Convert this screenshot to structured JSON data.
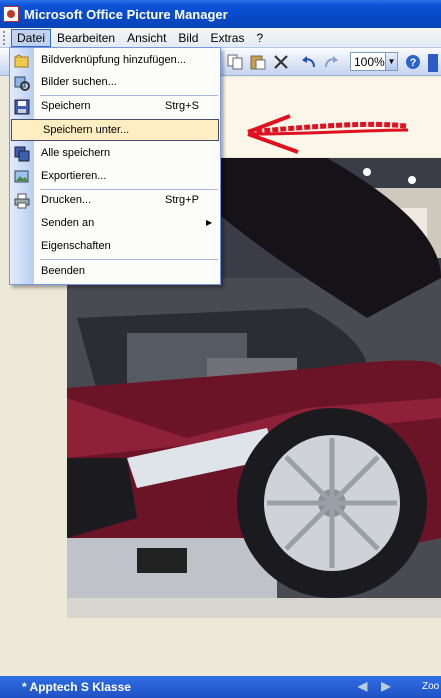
{
  "window": {
    "title": "Microsoft Office Picture Manager"
  },
  "menubar": {
    "items": [
      {
        "label": "Datei"
      },
      {
        "label": "Bearbeiten"
      },
      {
        "label": "Ansicht"
      },
      {
        "label": "Bild"
      },
      {
        "label": "Extras"
      },
      {
        "label": "?"
      }
    ]
  },
  "toolbar": {
    "zoom_value": "100%"
  },
  "file_menu": {
    "items": [
      {
        "label": "Bildverknüpfung hinzufügen...",
        "shortcut": ""
      },
      {
        "label": "Bilder suchen...",
        "shortcut": ""
      },
      {
        "label": "Speichern",
        "shortcut": "Strg+S"
      },
      {
        "label": "Speichern unter...",
        "shortcut": "",
        "highlighted": true
      },
      {
        "label": "Alle speichern",
        "shortcut": ""
      },
      {
        "label": "Exportieren...",
        "shortcut": ""
      },
      {
        "label": "Drucken...",
        "shortcut": "Strg+P"
      },
      {
        "label": "Senden an",
        "shortcut": "",
        "submenu": true
      },
      {
        "label": "Eigenschaften",
        "shortcut": ""
      },
      {
        "label": "Beenden",
        "shortcut": ""
      }
    ]
  },
  "status": {
    "file_name": "* Apptech S Klasse",
    "zoom_label": "Zoo"
  },
  "colors": {
    "titlebar": "#0a52d6",
    "highlight": "#ffeec2",
    "annotation_arrow": "#e01020"
  }
}
